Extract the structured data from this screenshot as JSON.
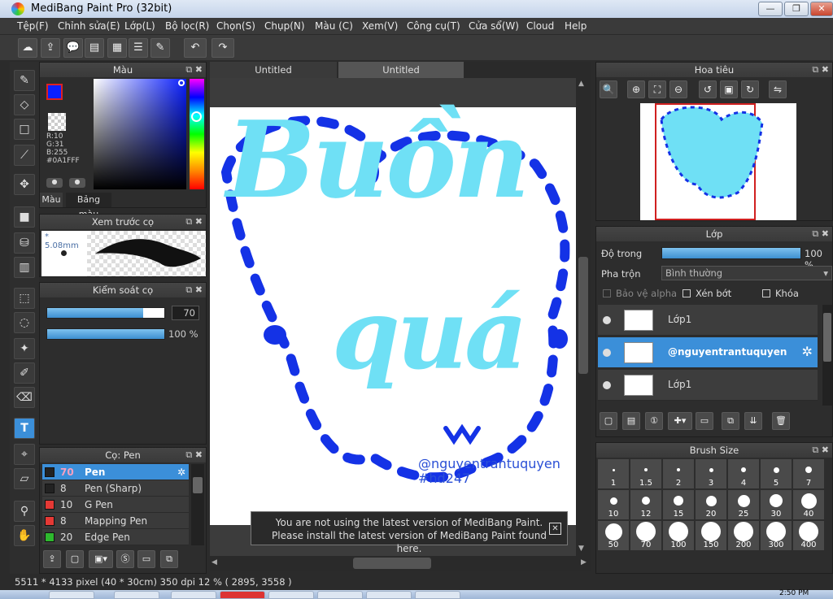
{
  "window": {
    "title": "MediBang Paint Pro (32bit)"
  },
  "menu": [
    "Tệp(F)",
    "Chỉnh sửa(E)",
    "Lớp(L)",
    "Bộ lọc(R)",
    "Chọn(S)",
    "Chụp(N)",
    "Màu (C)",
    "Xem(V)",
    "Công cụ(T)",
    "Cửa sổ(W)",
    "Cloud",
    "Help"
  ],
  "tabs": [
    "Untitled",
    "Untitled"
  ],
  "color_panel": {
    "title": "Màu",
    "r": "R:10",
    "g": "G:31",
    "b": "B:255",
    "hex": "#0A1FFF",
    "tab1": "Màu",
    "tab2": "Bảng màu",
    "fg": "#0A1FFF",
    "bg": "#6fe0f5"
  },
  "preview_panel": {
    "title": "Xem trước cọ",
    "size": "* 5.08mm"
  },
  "brush_control": {
    "title": "Kiểm soát cọ",
    "size_value": "70",
    "size_level": 0.82,
    "opacity_value": "100 %",
    "opacity_level": 1.0
  },
  "brush_panel": {
    "title": "Cọ: Pen",
    "items": [
      {
        "size": "70",
        "name": "Pen",
        "color": "#222222",
        "selected": true
      },
      {
        "size": "8",
        "name": "Pen (Sharp)",
        "color": "#222222",
        "selected": false
      },
      {
        "size": "10",
        "name": "G Pen",
        "color": "#e53935",
        "selected": false
      },
      {
        "size": "8",
        "name": "Mapping Pen",
        "color": "#e53935",
        "selected": false
      },
      {
        "size": "20",
        "name": "Edge Pen",
        "color": "#2eb82e",
        "selected": false
      }
    ]
  },
  "canvas": {
    "title_line1": "Buồn",
    "title_line2": "quá",
    "watermark1": "@nguyentrantuquyen",
    "watermark2": "#hd247"
  },
  "notice": {
    "line1": "You are not using the latest version of MediBang Paint.",
    "line2": "Please install the latest version of MediBang Paint found here.",
    "close": "✕"
  },
  "navigator": {
    "title": "Hoa tiêu"
  },
  "layer_panel": {
    "title": "Lớp",
    "opacity_label": "Độ trong",
    "opacity_value": "100 %",
    "opacity_level": 1.0,
    "blend_label": "Pha trộn",
    "blend_value": "Bình thường",
    "protect_alpha": "Bảo vệ alpha",
    "clipping": "Xén bớt",
    "lock": "Khóa",
    "layers": [
      {
        "name": "Lớp1",
        "selected": false
      },
      {
        "name": "@nguyentrantuquyen",
        "selected": true
      },
      {
        "name": "Lớp1",
        "selected": false
      }
    ]
  },
  "brush_size_panel": {
    "title": "Brush Size",
    "row1": [
      "1",
      "1.5",
      "2",
      "3",
      "4",
      "5",
      "7"
    ],
    "row2": [
      "10",
      "12",
      "15",
      "20",
      "25",
      "30",
      "40"
    ],
    "row3": [
      "50",
      "70",
      "100",
      "150",
      "200",
      "300",
      "400"
    ]
  },
  "status": {
    "text": "5511 * 4133 pixel   (40 * 30cm)   350 dpi   12 %   ( 2895, 3558 )"
  },
  "clock": "2:50 PM"
}
